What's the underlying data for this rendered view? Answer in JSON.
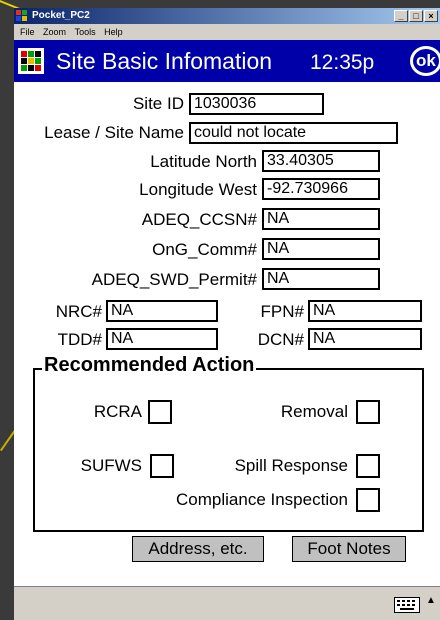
{
  "window": {
    "title": "Pocket_PC2",
    "buttons": [
      "_",
      "□",
      "×"
    ]
  },
  "menu": [
    "File",
    "Zoom",
    "Tools",
    "Help"
  ],
  "header": {
    "title": "Site Basic Infomation",
    "time": "12:35p",
    "ok_label": "ok"
  },
  "fields": {
    "site_id": {
      "label": "Site ID",
      "value": "1030036"
    },
    "lease_site_name": {
      "label": "Lease / Site Name",
      "value": "could not locate"
    },
    "latitude_north": {
      "label": "Latitude North",
      "value": "33.40305"
    },
    "longitude_west": {
      "label": "Longitude West",
      "value": "-92.730966"
    },
    "adeq_ccsn": {
      "label": "ADEQ_CCSN#",
      "value": "NA"
    },
    "ong_comm": {
      "label": "OnG_Comm#",
      "value": "NA"
    },
    "adeq_swd_permit": {
      "label": "ADEQ_SWD_Permit#",
      "value": "NA"
    },
    "nrc": {
      "label": "NRC#",
      "value": "NA"
    },
    "fpn": {
      "label": "FPN#",
      "value": "NA"
    },
    "tdd": {
      "label": "TDD#",
      "value": "NA"
    },
    "dcn": {
      "label": "DCN#",
      "value": "NA"
    }
  },
  "recommended_action": {
    "title": "Recommended Action",
    "options": {
      "rcra": "RCRA",
      "removal": "Removal",
      "sufws": "SUFWS",
      "spill_response": "Spill Response",
      "compliance_inspection": "Compliance Inspection"
    }
  },
  "buttons": {
    "address": "Address, etc.",
    "foot_notes": "Foot Notes"
  },
  "icons": {
    "app": "map-icon",
    "keyboard": "keyboard-icon",
    "sip_arrow": "up-arrow-icon"
  }
}
